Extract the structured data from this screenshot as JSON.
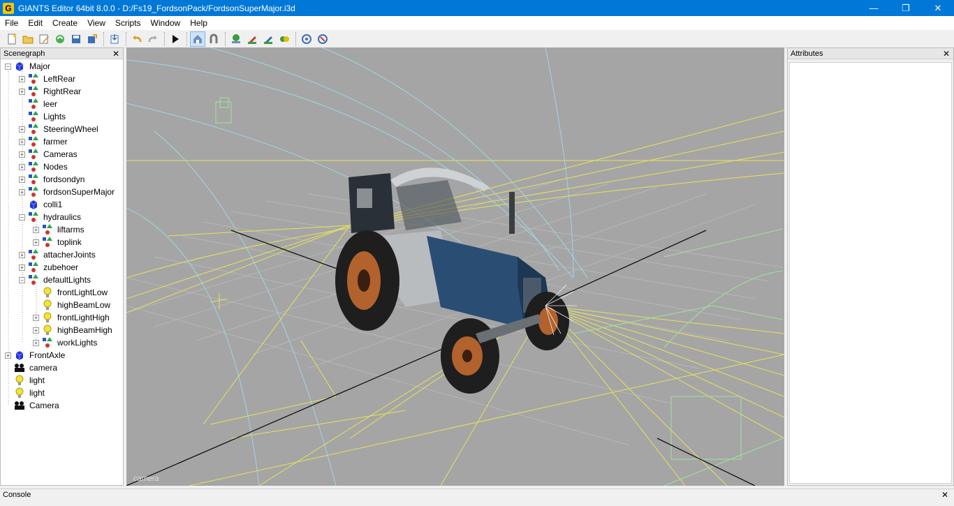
{
  "window": {
    "title": "GIANTS Editor 64bit 8.0.0 - D:/Fs19_FordsonPack/FordsonSuperMajor.i3d",
    "app_icon": "G",
    "min_icon": "minimize-icon",
    "restore_icon": "restore-icon",
    "close_icon": "close-icon"
  },
  "menu": [
    "File",
    "Edit",
    "Create",
    "View",
    "Scripts",
    "Window",
    "Help"
  ],
  "toolbar": {
    "buttons": [
      "new-file",
      "open-file",
      "edit-script",
      "reload",
      "save",
      "export",
      "import",
      "undo",
      "redo",
      "play",
      "select-mode",
      "magnet",
      "add-tree",
      "paint-terrain",
      "paint-foliage",
      "place-object",
      "script-run",
      "script-stop"
    ]
  },
  "scenegraph": {
    "title": "Scenegraph",
    "nodes": [
      {
        "label": "Major",
        "type": "shape",
        "depth": 0,
        "expander": "minus"
      },
      {
        "label": "LeftRear",
        "type": "transform",
        "depth": 1,
        "expander": "plus"
      },
      {
        "label": "RightRear",
        "type": "transform",
        "depth": 1,
        "expander": "plus"
      },
      {
        "label": "leer",
        "type": "transform",
        "depth": 1,
        "expander": "none"
      },
      {
        "label": "Lights",
        "type": "transform",
        "depth": 1,
        "expander": "none"
      },
      {
        "label": "SteeringWheel",
        "type": "transform",
        "depth": 1,
        "expander": "plus"
      },
      {
        "label": "farmer",
        "type": "transform",
        "depth": 1,
        "expander": "plus"
      },
      {
        "label": "Cameras",
        "type": "transform",
        "depth": 1,
        "expander": "plus"
      },
      {
        "label": "Nodes",
        "type": "transform",
        "depth": 1,
        "expander": "plus"
      },
      {
        "label": "fordsondyn",
        "type": "transform",
        "depth": 1,
        "expander": "plus"
      },
      {
        "label": "fordsonSuperMajor",
        "type": "transform",
        "depth": 1,
        "expander": "plus"
      },
      {
        "label": "colli1",
        "type": "shape",
        "depth": 1,
        "expander": "none"
      },
      {
        "label": "hydraulics",
        "type": "transform",
        "depth": 1,
        "expander": "minus"
      },
      {
        "label": "liftarms",
        "type": "transform",
        "depth": 2,
        "expander": "plus"
      },
      {
        "label": "toplink",
        "type": "transform",
        "depth": 2,
        "expander": "plus"
      },
      {
        "label": "attacherJoints",
        "type": "transform",
        "depth": 1,
        "expander": "plus"
      },
      {
        "label": "zubehoer",
        "type": "transform",
        "depth": 1,
        "expander": "plus"
      },
      {
        "label": "defaultLights",
        "type": "transform",
        "depth": 1,
        "expander": "minus"
      },
      {
        "label": "frontLightLow",
        "type": "light",
        "depth": 2,
        "expander": "none"
      },
      {
        "label": "highBeamLow",
        "type": "light",
        "depth": 2,
        "expander": "none"
      },
      {
        "label": "frontLightHigh",
        "type": "light",
        "depth": 2,
        "expander": "plus"
      },
      {
        "label": "highBeamHigh",
        "type": "light",
        "depth": 2,
        "expander": "plus"
      },
      {
        "label": "workLights",
        "type": "transform",
        "depth": 2,
        "expander": "plus"
      },
      {
        "label": "FrontAxle",
        "type": "shape",
        "depth": 0,
        "expander": "plus"
      },
      {
        "label": "camera",
        "type": "camera",
        "depth": 0,
        "expander": "none"
      },
      {
        "label": "light",
        "type": "light",
        "depth": 0,
        "expander": "none"
      },
      {
        "label": "light",
        "type": "light",
        "depth": 0,
        "expander": "none"
      },
      {
        "label": "Camera",
        "type": "camera",
        "depth": 0,
        "expander": "none"
      }
    ]
  },
  "viewport": {
    "camera_label": "camera",
    "background": "#a5a5a5"
  },
  "attributes": {
    "title": "Attributes"
  },
  "console": {
    "title": "Console"
  },
  "colors": {
    "titlebar": "#0078d7",
    "light_lines": "#e8e25a",
    "camera_lines": "#9fd7e8",
    "helper_lines": "#9fe49f"
  }
}
